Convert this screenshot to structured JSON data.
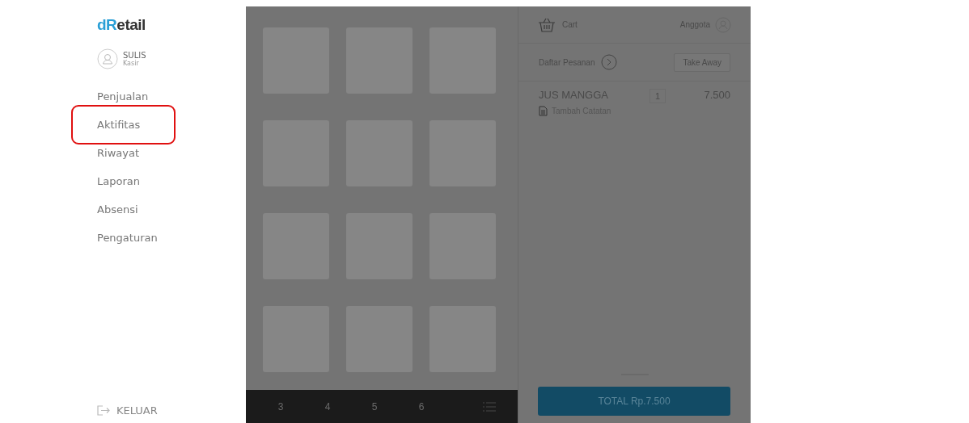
{
  "sidebar": {
    "logo": {
      "accent": "dR",
      "rest": "etail"
    },
    "user": {
      "name": "SULIS",
      "role": "Kasir"
    },
    "menu": [
      {
        "label": "Penjualan",
        "highlighted": false
      },
      {
        "label": "Aktifitas",
        "highlighted": true
      },
      {
        "label": "Riwayat",
        "highlighted": false
      },
      {
        "label": "Laporan",
        "highlighted": false
      },
      {
        "label": "Absensi",
        "highlighted": false
      },
      {
        "label": "Pengaturan",
        "highlighted": false
      }
    ],
    "logout": "KELUAR"
  },
  "products": {
    "pages": [
      "3",
      "4",
      "5",
      "6"
    ]
  },
  "cart": {
    "title": "Cart",
    "member": "Anggota",
    "order_list": "Daftar Pesanan",
    "order_type": "Take Away",
    "items": [
      {
        "name": "JUS MANGGA",
        "qty": "1",
        "price": "7.500",
        "note": "Tambah Catatan"
      }
    ],
    "total": "TOTAL Rp.7.500"
  }
}
